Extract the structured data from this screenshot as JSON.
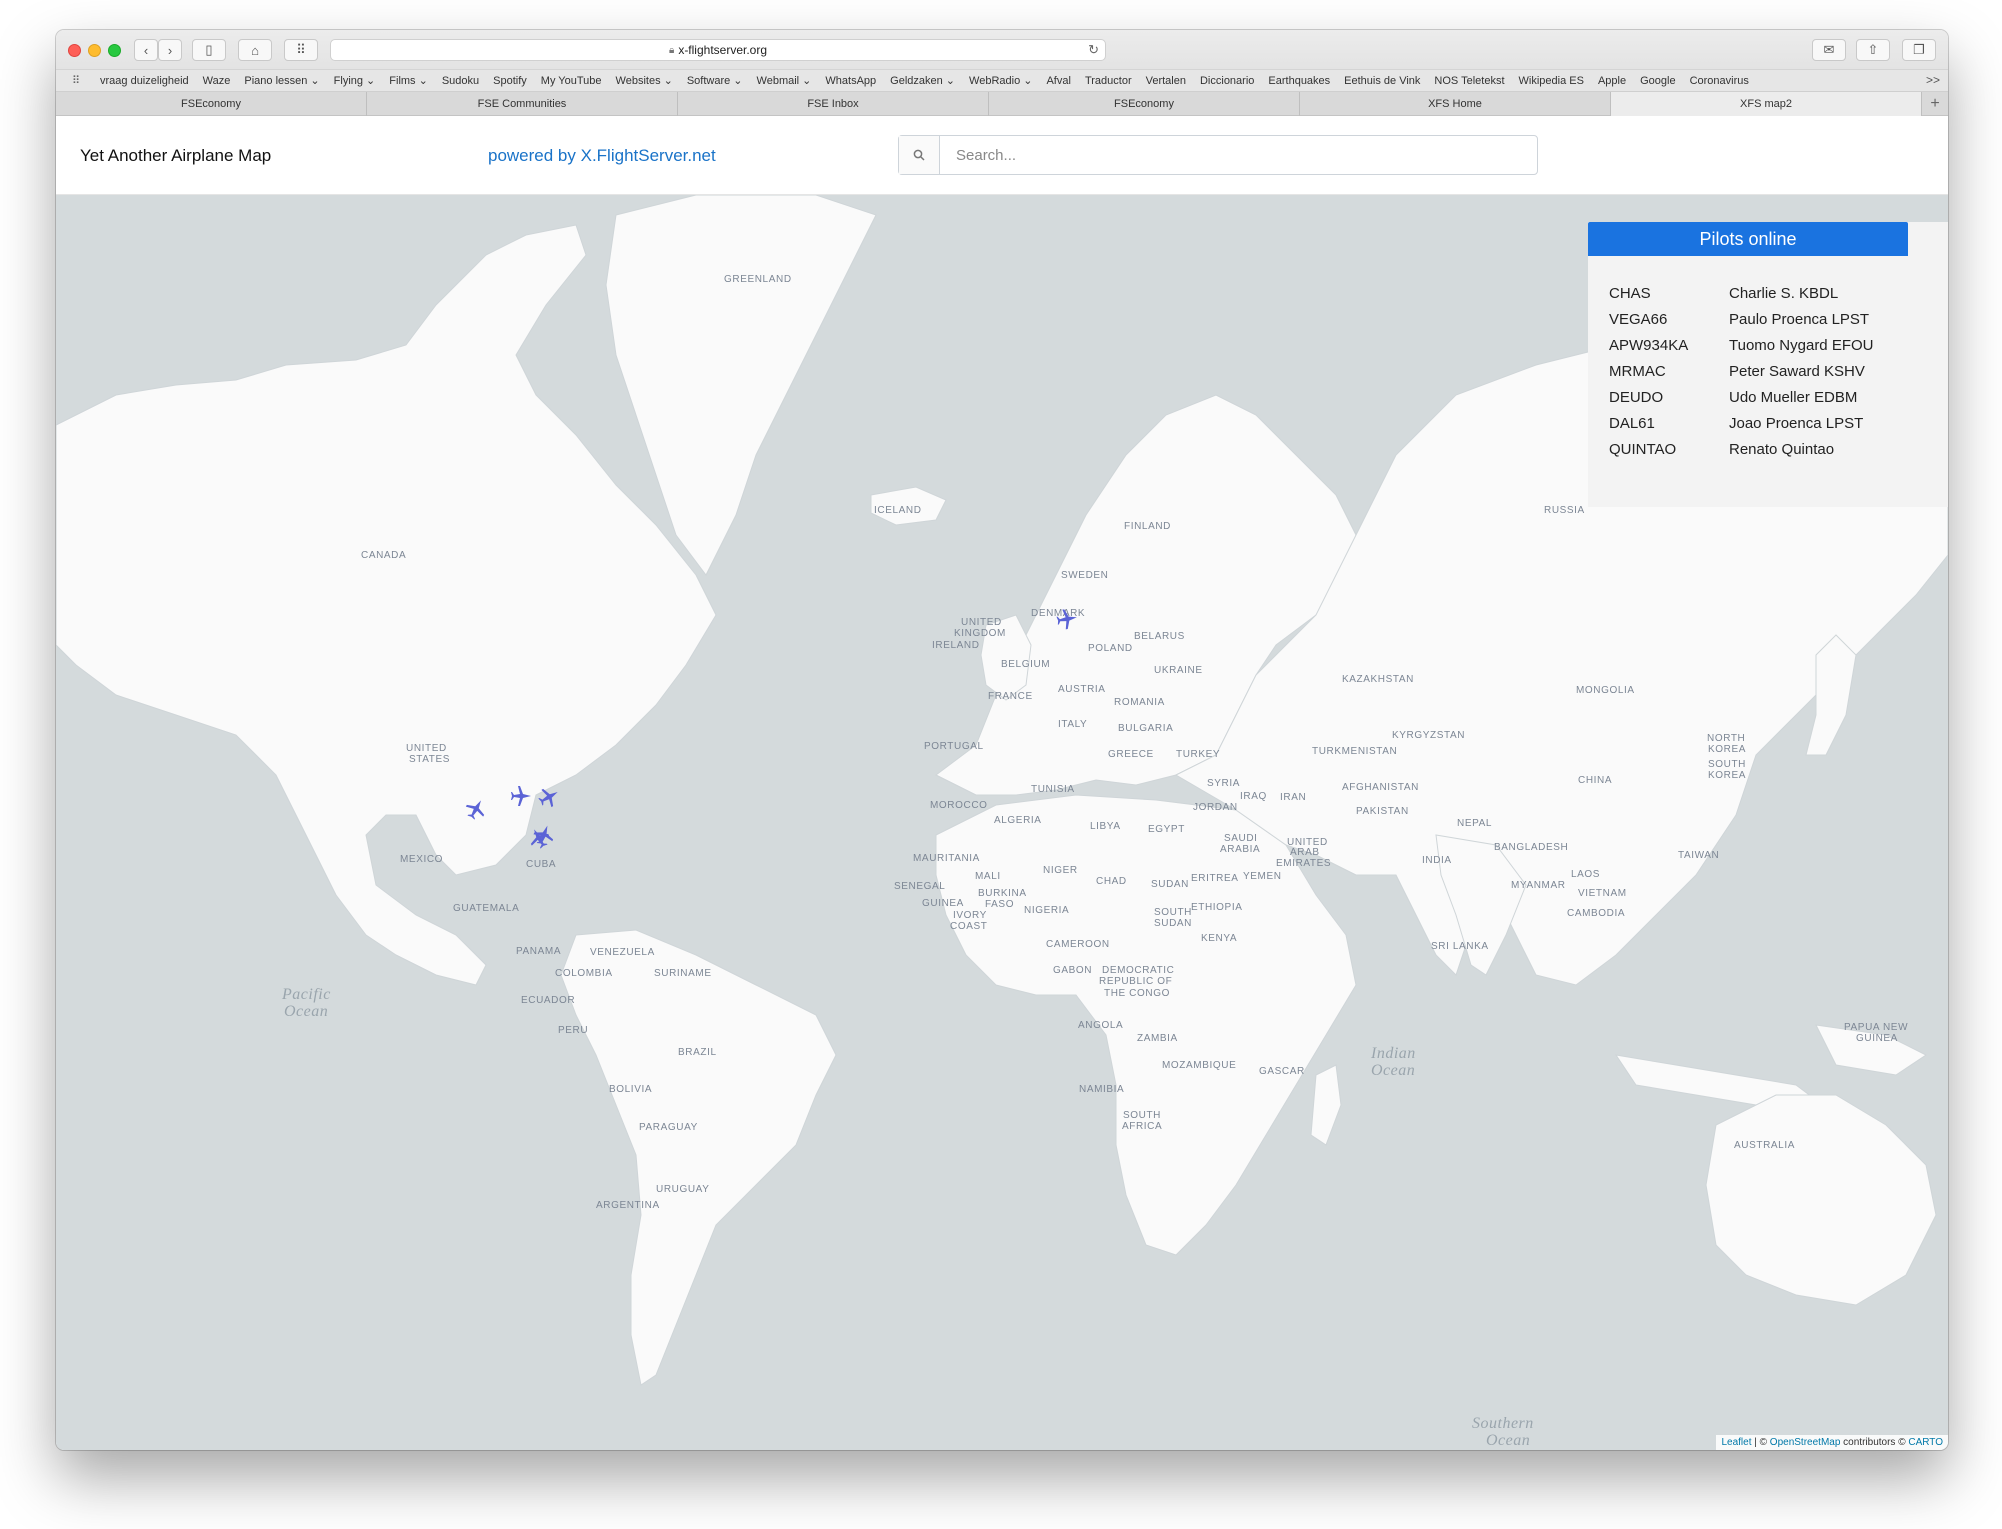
{
  "browser": {
    "url": "x-flightserver.org",
    "bookmarks": [
      "vraag duizeligheid",
      "Waze",
      "Piano lessen ⌄",
      "Flying ⌄",
      "Films ⌄",
      "Sudoku",
      "Spotify",
      "My YouTube",
      "Websites ⌄",
      "Software ⌄",
      "Webmail ⌄",
      "WhatsApp",
      "Geldzaken ⌄",
      "WebRadio ⌄",
      "Afval",
      "Traductor",
      "Vertalen",
      "Diccionario",
      "Earthquakes",
      "Eethuis de Vink",
      "NOS Teletekst",
      "Wikipedia ES",
      "Apple",
      "Google",
      "Coronavirus"
    ],
    "bookmarks_more": ">>",
    "tabs": [
      {
        "label": "FSEconomy",
        "active": false
      },
      {
        "label": "FSE Communities",
        "active": false
      },
      {
        "label": "FSE Inbox",
        "active": false
      },
      {
        "label": "FSEconomy",
        "active": false
      },
      {
        "label": "XFS Home",
        "active": false
      },
      {
        "label": "XFS map2",
        "active": true
      }
    ]
  },
  "header": {
    "title": "Yet Another Airplane Map",
    "powered": "powered by X.FlightServer.net",
    "search_placeholder": "Search..."
  },
  "map": {
    "labels": [
      "GREENLAND",
      "ICELAND",
      "CANADA",
      "UNITED",
      "STATES",
      "MEXICO",
      "CUBA",
      "GUATEMALA",
      "PANAMA",
      "VENEZUELA",
      "COLOMBIA",
      "SURINAME",
      "ECUADOR",
      "PERU",
      "BRAZIL",
      "BOLIVIA",
      "PARAGUAY",
      "URUGUAY",
      "ARGENTINA",
      "SWEDEN",
      "FINLAND",
      "DENMARK",
      "UNITED",
      "KINGDOM",
      "IRELAND",
      "BELGIUM",
      "FRANCE",
      "PORTUGAL",
      "POLAND",
      "BELARUS",
      "UKRAINE",
      "AUSTRIA",
      "ITALY",
      "ROMANIA",
      "BULGARIA",
      "GREECE",
      "TURKEY",
      "TUNISIA",
      "MOROCCO",
      "ALGERIA",
      "LIBYA",
      "EGYPT",
      "MAURITANIA",
      "MALI",
      "NIGER",
      "CHAD",
      "SUDAN",
      "SENEGAL",
      "GUINEA",
      "BURKINA",
      "FASO",
      "IVORY",
      "COAST",
      "NIGERIA",
      "CAMEROON",
      "GABON",
      "DEMOCRATIC",
      "REPUBLIC OF",
      "THE CONGO",
      "SOUTH",
      "SUDAN",
      "ETHIOPIA",
      "ERITREA",
      "YEMEN",
      "KENYA",
      "ANGOLA",
      "ZAMBIA",
      "MOZAMBIQUE",
      "NAMIBIA",
      "SOUTH",
      "AFRICA",
      "SYRIA",
      "IRAQ",
      "IRAN",
      "JORDAN",
      "SAUDI",
      "ARABIA",
      "UNITED",
      "ARAB",
      "EMIRATES",
      "AFGHANISTAN",
      "PAKISTAN",
      "INDIA",
      "NEPAL",
      "BANGLADESH",
      "SRI LANKA",
      "MYANMAR",
      "LAOS",
      "VIETNAM",
      "CAMBODIA",
      "CHINA",
      "MONGOLIA",
      "KAZAKHSTAN",
      "KYRGYZSTAN",
      "TURKMENISTAN",
      "RUSSIA",
      "NORTH",
      "KOREA",
      "SOUTH",
      "KOREA",
      "TAIWAN",
      "PAPUA NEW",
      "GUINEA",
      "AUSTRALIA",
      "GASCAR"
    ],
    "oceans": [
      "Pacific",
      "Ocean",
      "Indian",
      "Ocean",
      "Southern",
      "Ocean"
    ]
  },
  "pilots": {
    "heading": "Pilots online",
    "rows": [
      {
        "callsign": "CHAS",
        "name": "Charlie S. KBDL"
      },
      {
        "callsign": "VEGA66",
        "name": "Paulo Proenca LPST"
      },
      {
        "callsign": "APW934KA",
        "name": "Tuomo Nygard EFOU"
      },
      {
        "callsign": "MRMAC",
        "name": "Peter Saward KSHV"
      },
      {
        "callsign": "DEUDO",
        "name": "Udo Mueller EDBM"
      },
      {
        "callsign": "DAL61",
        "name": "Joao Proenca LPST"
      },
      {
        "callsign": "QUINTAO",
        "name": "Renato Quintao"
      }
    ]
  },
  "attribution": {
    "leaflet": "Leaflet",
    "sep1": " | © ",
    "osm": "OpenStreetMap",
    "mid": " contributors © ",
    "carto": "CARTO"
  },
  "colors": {
    "accent": "#1a73e0",
    "link": "#1a73c8",
    "water": "#d4dadc",
    "land": "#fafafa",
    "aircraft": "#5b63d6"
  },
  "icons": [
    "search-icon",
    "airplane-icon",
    "reload-icon",
    "lock-icon",
    "home-icon",
    "sidebar-icon",
    "grid-icon",
    "mail-icon",
    "share-icon",
    "tabs-icon",
    "back-icon",
    "forward-icon"
  ]
}
